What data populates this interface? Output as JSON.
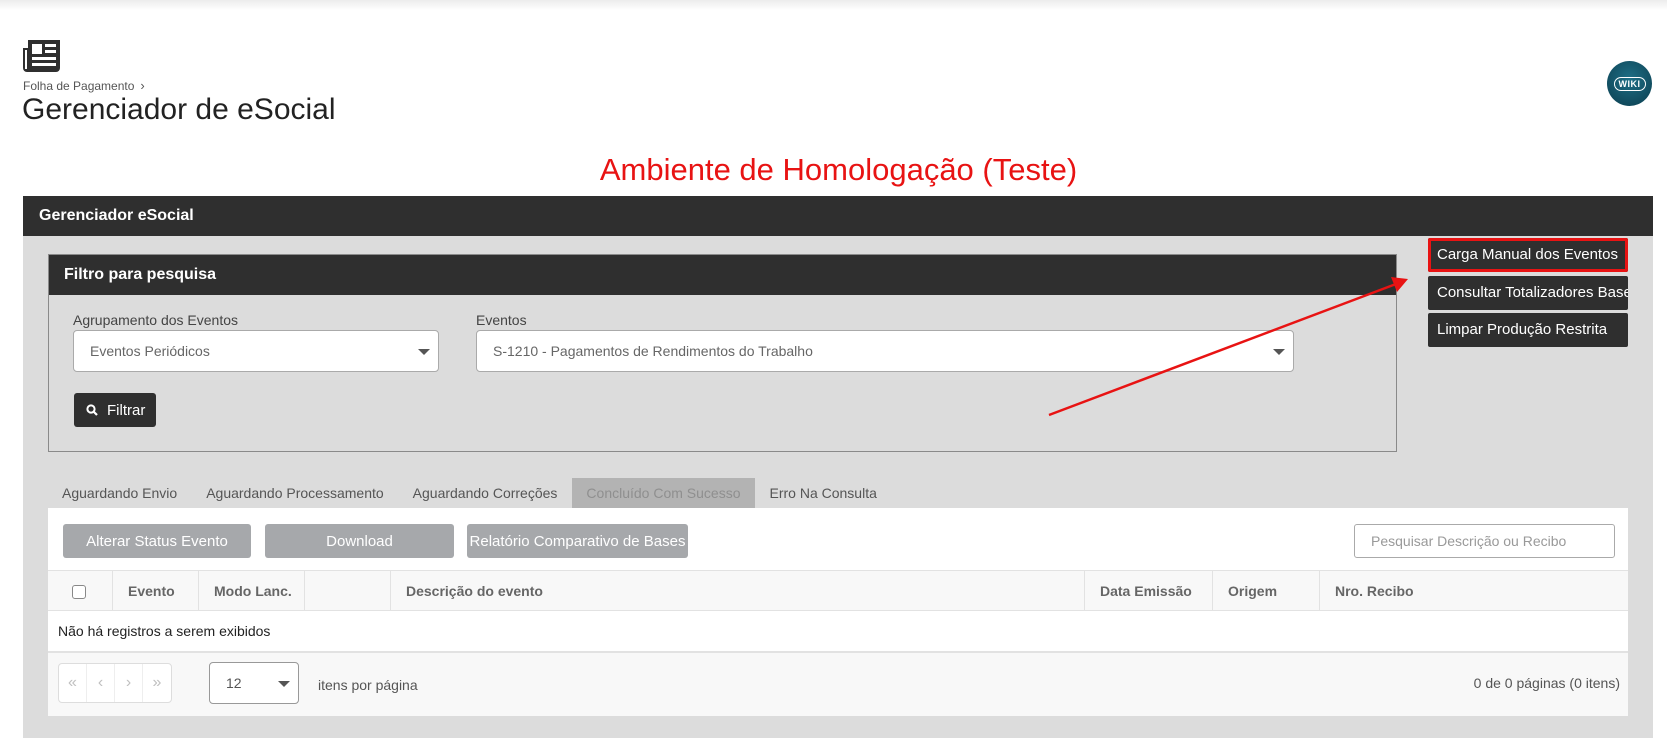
{
  "header": {
    "breadcrumb": "Folha de Pagamento",
    "breadcrumb_sep": "›",
    "title": "Gerenciador de eSocial",
    "wiki_label": "WIKI"
  },
  "environment_banner": "Ambiente de Homologação (Teste)",
  "panel": {
    "title": "Gerenciador eSocial"
  },
  "filter": {
    "title": "Filtro para pesquisa",
    "group_label": "Agrupamento dos Eventos",
    "group_value": "Eventos Periódicos",
    "events_label": "Eventos",
    "events_value": "S-1210 - Pagamentos de Rendimentos do Trabalho",
    "filter_button": "Filtrar"
  },
  "side_buttons": [
    "Carga Manual dos Eventos",
    "Consultar Totalizadores Base",
    "Limpar Produção Restrita"
  ],
  "tabs": [
    "Aguardando Envio",
    "Aguardando Processamento",
    "Aguardando Correções",
    "Concluído Com Sucesso",
    "Erro Na Consulta"
  ],
  "active_tab": "Concluído Com Sucesso",
  "toolbar": {
    "alter_status": "Alterar Status Evento",
    "download": "Download",
    "report": "Relatório Comparativo de Bases",
    "search_placeholder": "Pesquisar Descrição ou Recibo"
  },
  "table": {
    "columns": [
      "Evento",
      "Modo Lanc.",
      "",
      "Descrição do evento",
      "Data Emissão",
      "Origem",
      "Nro. Recibo"
    ],
    "empty_message": "Não há registros a serem exibidos"
  },
  "pagination": {
    "page_size": "12",
    "page_size_label": "itens por página",
    "info": "0 de 0 páginas (0 itens)",
    "first": "«",
    "prev": "‹",
    "next": "›",
    "last": "»"
  },
  "colors": {
    "dark": "#2f2f2f",
    "annotation_red": "#e81313",
    "panel_bg": "#dcdcdc",
    "gray_button": "#a6a8ab"
  }
}
